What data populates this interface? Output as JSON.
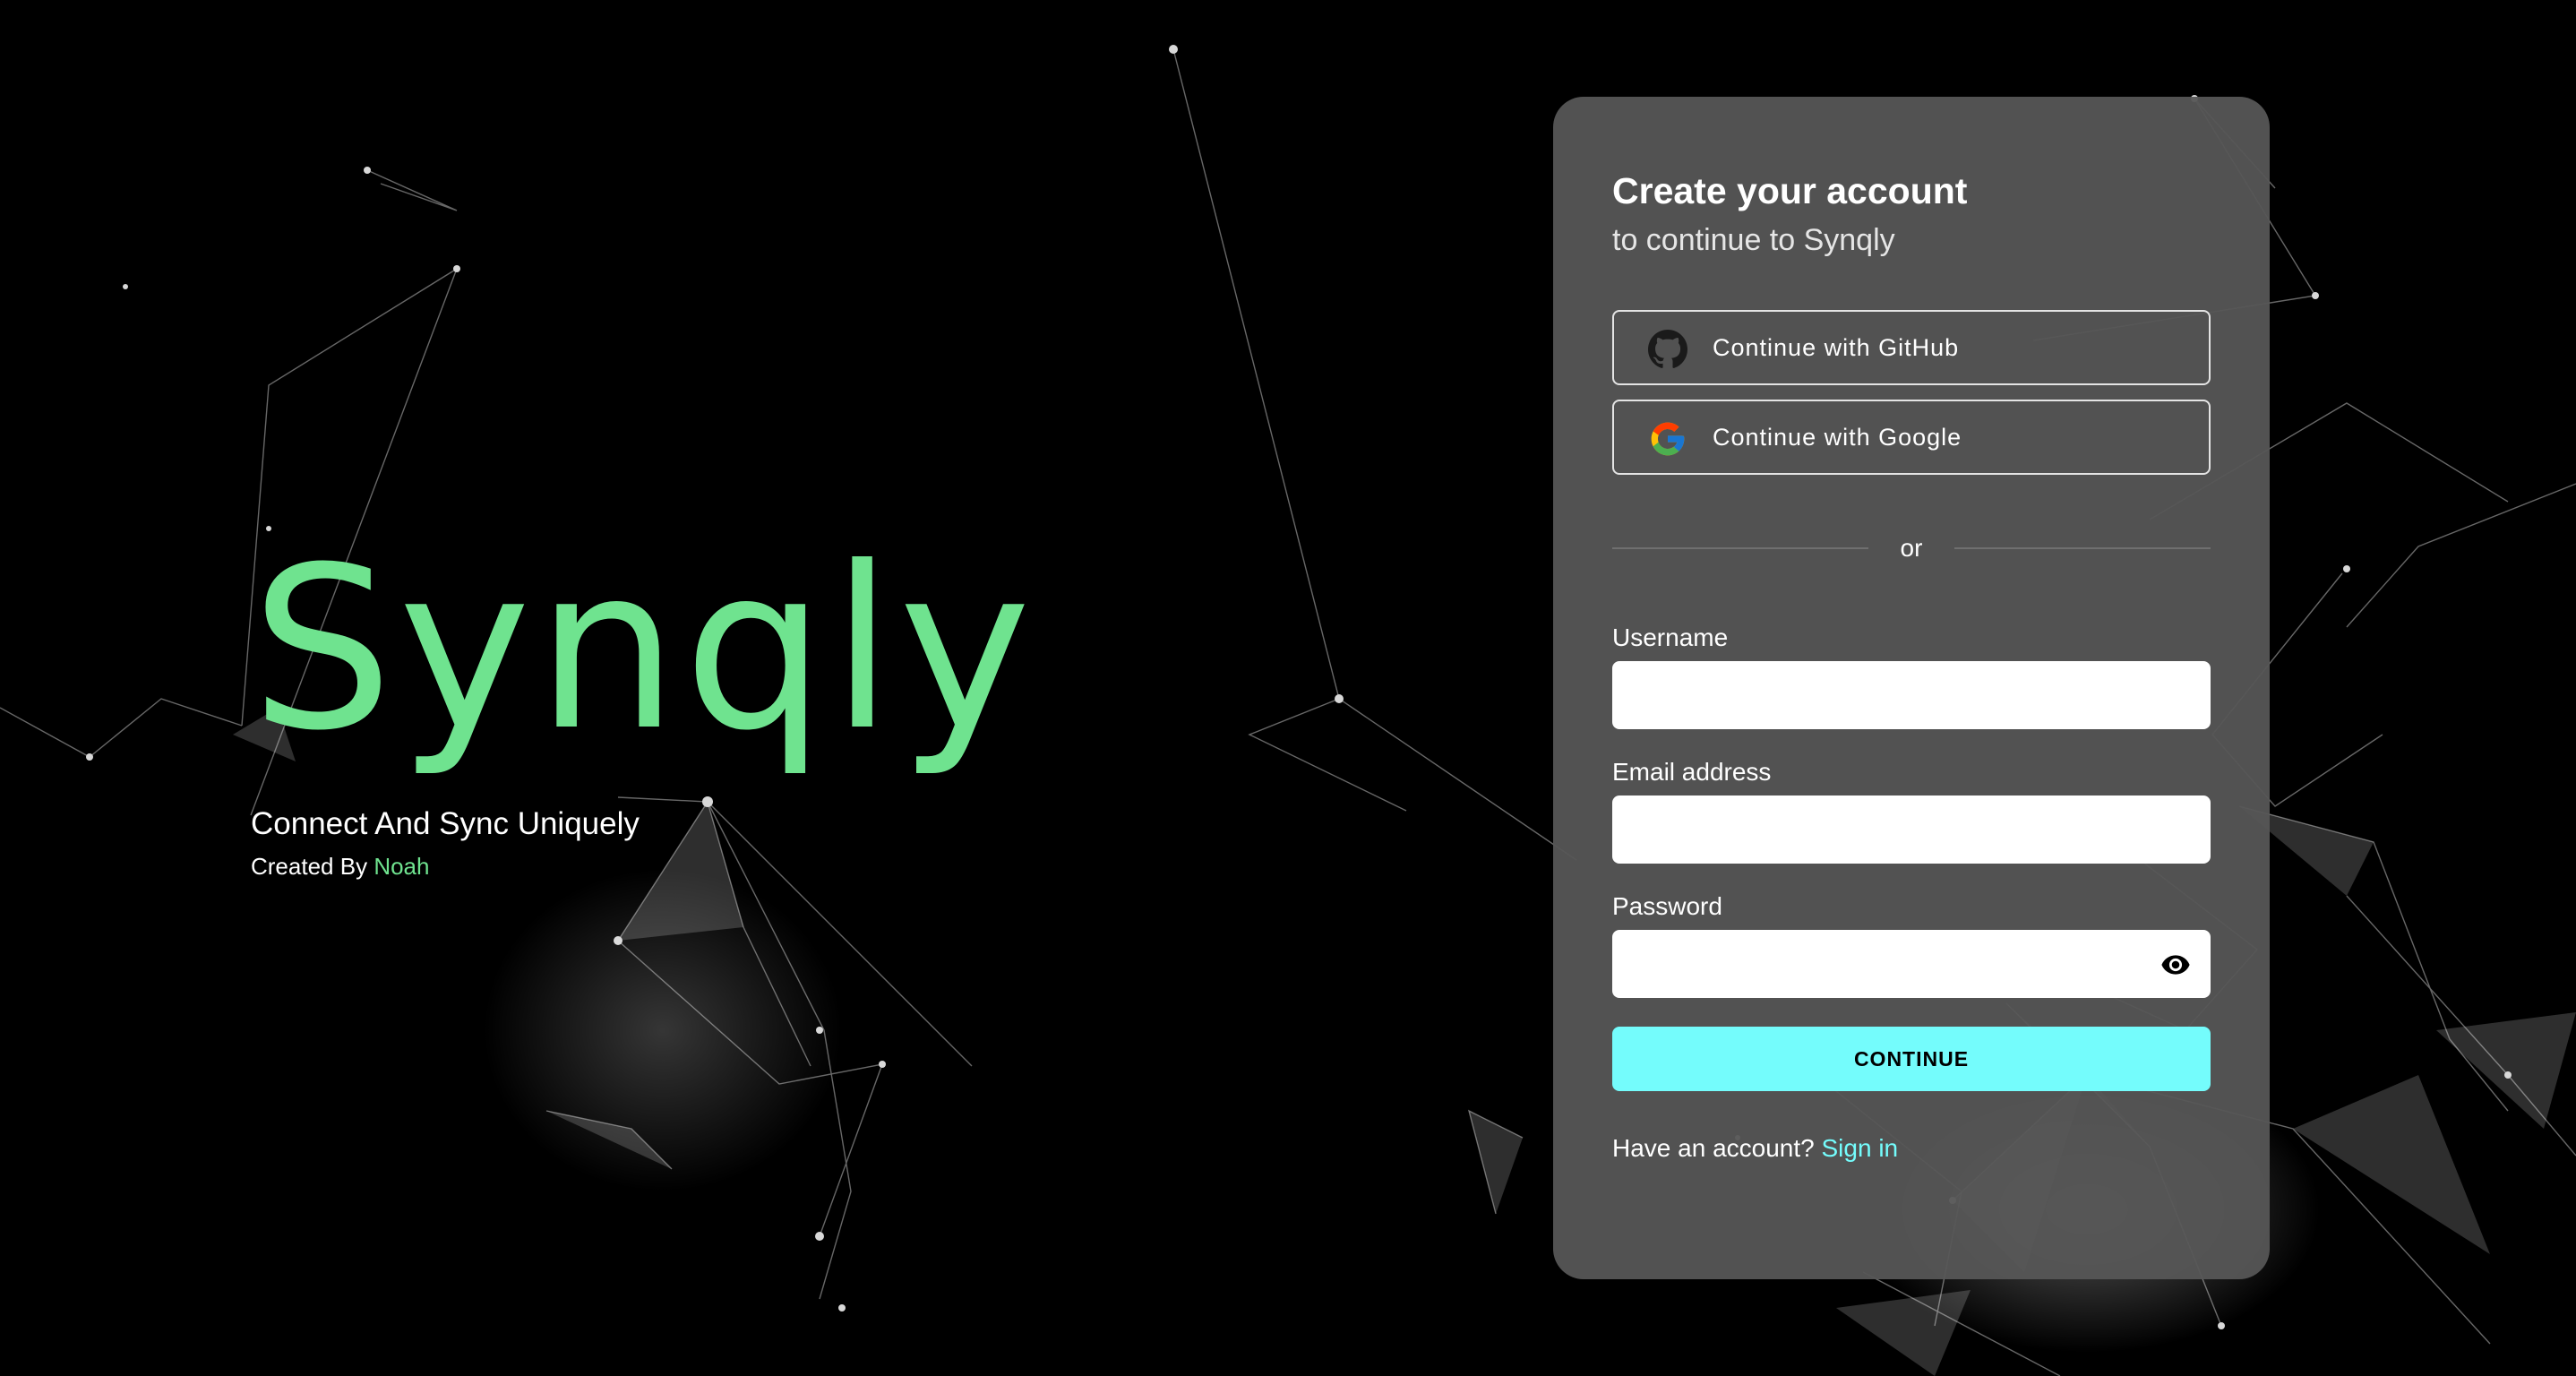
{
  "brand": {
    "logo_text": "Synqly",
    "tagline": "Connect And Sync Uniquely",
    "credit_prefix": "Created By",
    "credit_author": "Noah"
  },
  "card": {
    "title": "Create your account",
    "subtitle": "to continue to Synqly",
    "oauth": {
      "github_label": "Continue with GitHub",
      "google_label": "Continue with Google"
    },
    "divider_text": "or",
    "fields": {
      "username": {
        "label": "Username",
        "value": ""
      },
      "email": {
        "label": "Email address",
        "value": ""
      },
      "password": {
        "label": "Password",
        "value": ""
      }
    },
    "continue_label": "CONTINUE",
    "footer": {
      "prompt": "Have an account?",
      "link": "Sign in"
    }
  },
  "colors": {
    "background": "#000000",
    "brand_green": "#6fe38f",
    "accent_cyan": "#74fcfc",
    "card_bg": "#565656"
  },
  "icons": [
    "github-icon",
    "google-icon",
    "eye-icon"
  ]
}
